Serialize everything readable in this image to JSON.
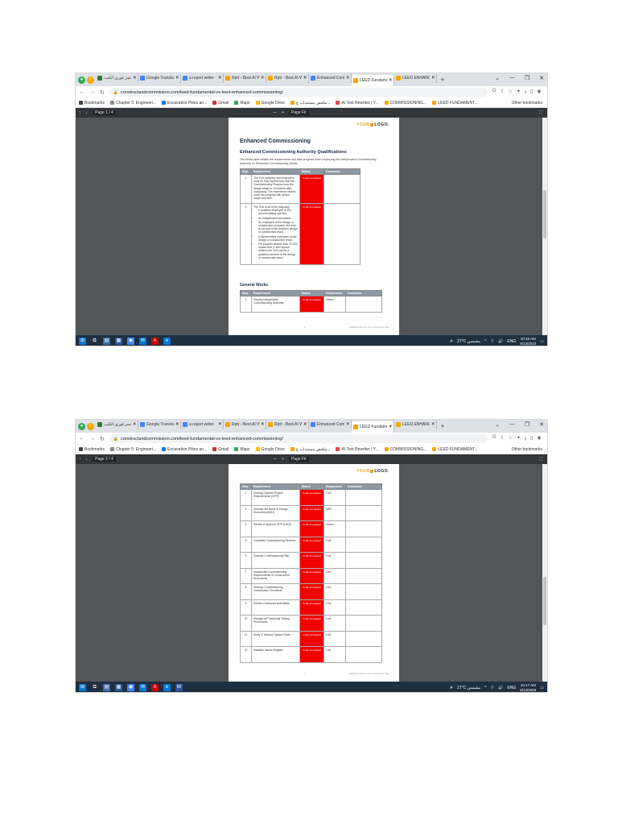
{
  "browser": {
    "tabs": [
      {
        "label": "متجر فوري الكتب",
        "favicon_color": "#2e7d32"
      },
      {
        "label": "Google Translat",
        "favicon_color": "#4285f4"
      },
      {
        "label": "a report writer",
        "favicon_color": "#4285f4"
      },
      {
        "label": "Rptr - Best AI W",
        "favicon_color": "#f6a500"
      },
      {
        "label": "Rptr - Best AI W",
        "favicon_color": "#f6a500"
      },
      {
        "label": "Enhanced Com",
        "favicon_color": "#4285f4"
      },
      {
        "label": "LEED Fundamen",
        "favicon_color": "#f6a500"
      },
      {
        "label": "LEED ENHANC",
        "favicon_color": "#f6a500"
      }
    ],
    "active_tab": 6,
    "new_tab": "+",
    "url": "constructandcommission.com/leed-fundamental-vs-leed-enhanced-commissioning/",
    "window_controls": [
      "⌄",
      "—",
      "❐",
      "✕"
    ],
    "bookmarks": [
      {
        "label": "Bookmarks",
        "color": "#444"
      },
      {
        "label": "Chapter 5: Engineeri...",
        "color": "#888"
      },
      {
        "label": "Excavation Pikes an...",
        "color": "#1a73e8"
      },
      {
        "label": "Gmail",
        "color": "#d93025"
      },
      {
        "label": "Maps",
        "color": "#34a853"
      },
      {
        "label": "Google Drive",
        "color": "#fbbc04"
      },
      {
        "label": "ملخص مستندات ج...",
        "color": "#f6a500"
      },
      {
        "label": "AI Text Rewriter | Y...",
        "color": "#e8453c"
      },
      {
        "label": "COMMISSIONING...",
        "color": "#f6a500"
      },
      {
        "label": "LEED FUNDAMENT...",
        "color": "#f6a500"
      }
    ],
    "other_bookmarks": "Other bookmarks"
  },
  "shots": [
    {
      "page_indicator": "Page  1  / 4",
      "zoom_label": "Page Fit",
      "time": "10:16 AM",
      "date": "8/13/2023",
      "scroll_position": 0.3
    },
    {
      "page_indicator": "Page  2  / 4",
      "zoom_label": "Page Fit",
      "time": "10:17 AM",
      "date": "8/13/2023",
      "scroll_position": 0.55
    }
  ],
  "taskbar": {
    "weather": "27°C  مشمس",
    "lang": "ENG"
  },
  "document": {
    "logo_your": "YOUR",
    "logo_rest": "LOGO.",
    "title": "Enhanced Commissioning",
    "subtitle": "Enhanced Commissioning Authority Qualifications",
    "intro": "The below table details the requirements and their progress when employing the independent Commissioning Authority for Enhanced Commissioning Works.",
    "headers": {
      "step": "Step",
      "requirement": "Requirement",
      "status": "Status",
      "responsible": "Responsible",
      "comments": "Comments"
    },
    "qual_rows": [
      {
        "step": "1",
        "requirement": "The CxA company and Engineers must be fully experienced with the Commissioning Process from the design stage to 10 months after occupancy. The experience should cover two projects with similar scope and size.",
        "status": "To Be Completed"
      },
      {
        "step": "2",
        "requirement_intro": "The CxA is all of the following:",
        "bullets": [
          "A qualified employee of the owner/building operator.",
          "An independent consultant.",
          "An employee of the design or construction company, but who is not part of the project's design or construction team.",
          "A disinterested contractor of the design or construction team.",
          "For projects smaller than 20,000 square feet (1,860 square meters) the CxA can be a qualified member of the design or construction team."
        ],
        "status": "To Be Completed"
      }
    ],
    "general_heading": "General Works",
    "general_rows": [
      {
        "step": "1",
        "requirement": "Employ Independent Commissioning Authority",
        "status": "To Be Completed",
        "responsible": "Owner"
      }
    ],
    "page2_rows": [
      {
        "step": "2",
        "requirement": "Develop Owners Project Requirements (OPR)",
        "status": "To Be Completed",
        "responsible": "CxA"
      },
      {
        "step": "3",
        "requirement": "Develop the Basis of Design Document (BOD)",
        "status": "To Be Completed",
        "responsible": "MEP"
      },
      {
        "step": "4",
        "requirement": "Review & Approve OPR & BOD",
        "status": "To Be Completed",
        "responsible": "Owner"
      },
      {
        "step": "5",
        "requirement": "Complete Commissioning Reviews",
        "status": "To Be Completed",
        "responsible": "CxA"
      },
      {
        "step": "6",
        "requirement": "Develop Commissioning Plan",
        "status": "To Be Completed",
        "responsible": "CxA"
      },
      {
        "step": "7",
        "requirement": "Incorporate Commissioning Requirements in Construction Documents",
        "status": "To Be Completed",
        "responsible": "CxA"
      },
      {
        "step": "8",
        "requirement": "Develop Commissioning Construction Checklists",
        "status": "To Be Completed",
        "responsible": "CxA"
      },
      {
        "step": "9",
        "requirement": "Review Contractor Submittals",
        "status": "To Be Completed",
        "responsible": "CxA"
      },
      {
        "step": "10",
        "requirement": "Manage all Functional Testing Procedures",
        "status": "To Be Completed",
        "responsible": "CxA"
      },
      {
        "step": "11",
        "requirement": "Verify & Witness System Tests",
        "status": "To Be Completed",
        "responsible": "CxA"
      },
      {
        "step": "12",
        "requirement": "Maintain Issues Register",
        "status": "To Be Completed",
        "responsible": "CxA"
      }
    ],
    "footer_page1": "1",
    "footer_page2": "2",
    "footer_text": "LEED Enhanced Commissioning Plan"
  }
}
